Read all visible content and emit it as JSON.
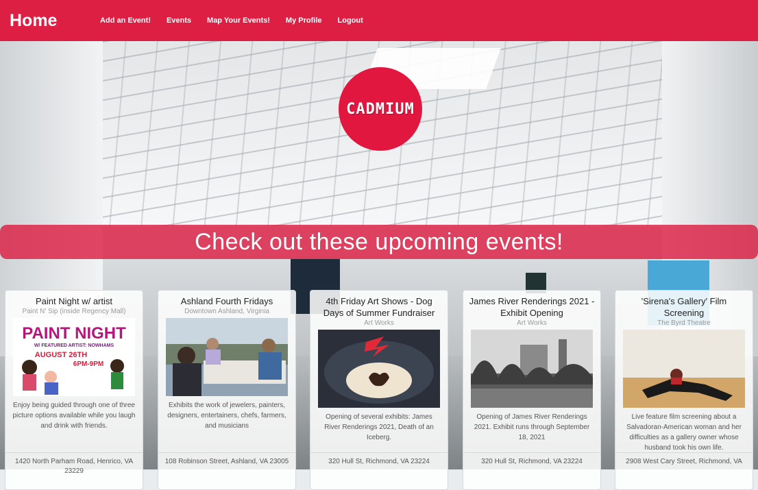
{
  "nav": {
    "brand": "Home",
    "links": [
      "Add an Event!",
      "Events",
      "Map Your Events!",
      "My Profile",
      "Logout"
    ]
  },
  "logo": {
    "text": "CADMIUM"
  },
  "banner": {
    "text": "Check out these upcoming events!"
  },
  "events": [
    {
      "title": "Paint Night w/ artist",
      "venue": "Paint N' Sip (inside Regency Mall)",
      "description": "Enjoy being guided through one of three picture options available while you laugh and drink with friends.",
      "address": "1420 North Parham Road, Henrico, VA 23229",
      "poster": {
        "headline": "PAINT NIGHT",
        "subline": "W/ FEATURED ARTIST: NOWHAMS",
        "date": "AUGUST 26TH",
        "time": "6PM-9PM"
      }
    },
    {
      "title": "Ashland Fourth Fridays",
      "venue": "Downtown Ashland, Virginia",
      "description": "Exhibits the work of jewelers, painters, designers, entertainers, chefs, farmers, and musicians",
      "address": "108 Robinson Street, Ashland, VA 23005"
    },
    {
      "title": "4th Friday Art Shows - Dog Days of Summer Fundraiser",
      "venue": "Art Works",
      "description": "Opening of several exhibits: James River Renderings 2021, Death of an Iceberg.",
      "address": "320 Hull St, Richmond, VA 23224"
    },
    {
      "title": "James River Renderings 2021 - Exhibit Opening",
      "venue": "Art Works",
      "description": "Opening of James River Renderings 2021. Exhibit runs through September 18, 2021",
      "address": "320 Hull St, Richmond, VA 23224"
    },
    {
      "title": "'Sirena's Gallery' Film Screening",
      "venue": "The Byrd Theatre",
      "description": "Live feature film screening about a Salvadoran-American woman and her difficulties as a gallery owner whose husband took his own life.",
      "address": "2908 West Cary Street, Richmond, VA"
    }
  ],
  "colors": {
    "brand": "#dc1f43",
    "banner": "#dc1f43",
    "card_bg": "#ffffff"
  }
}
